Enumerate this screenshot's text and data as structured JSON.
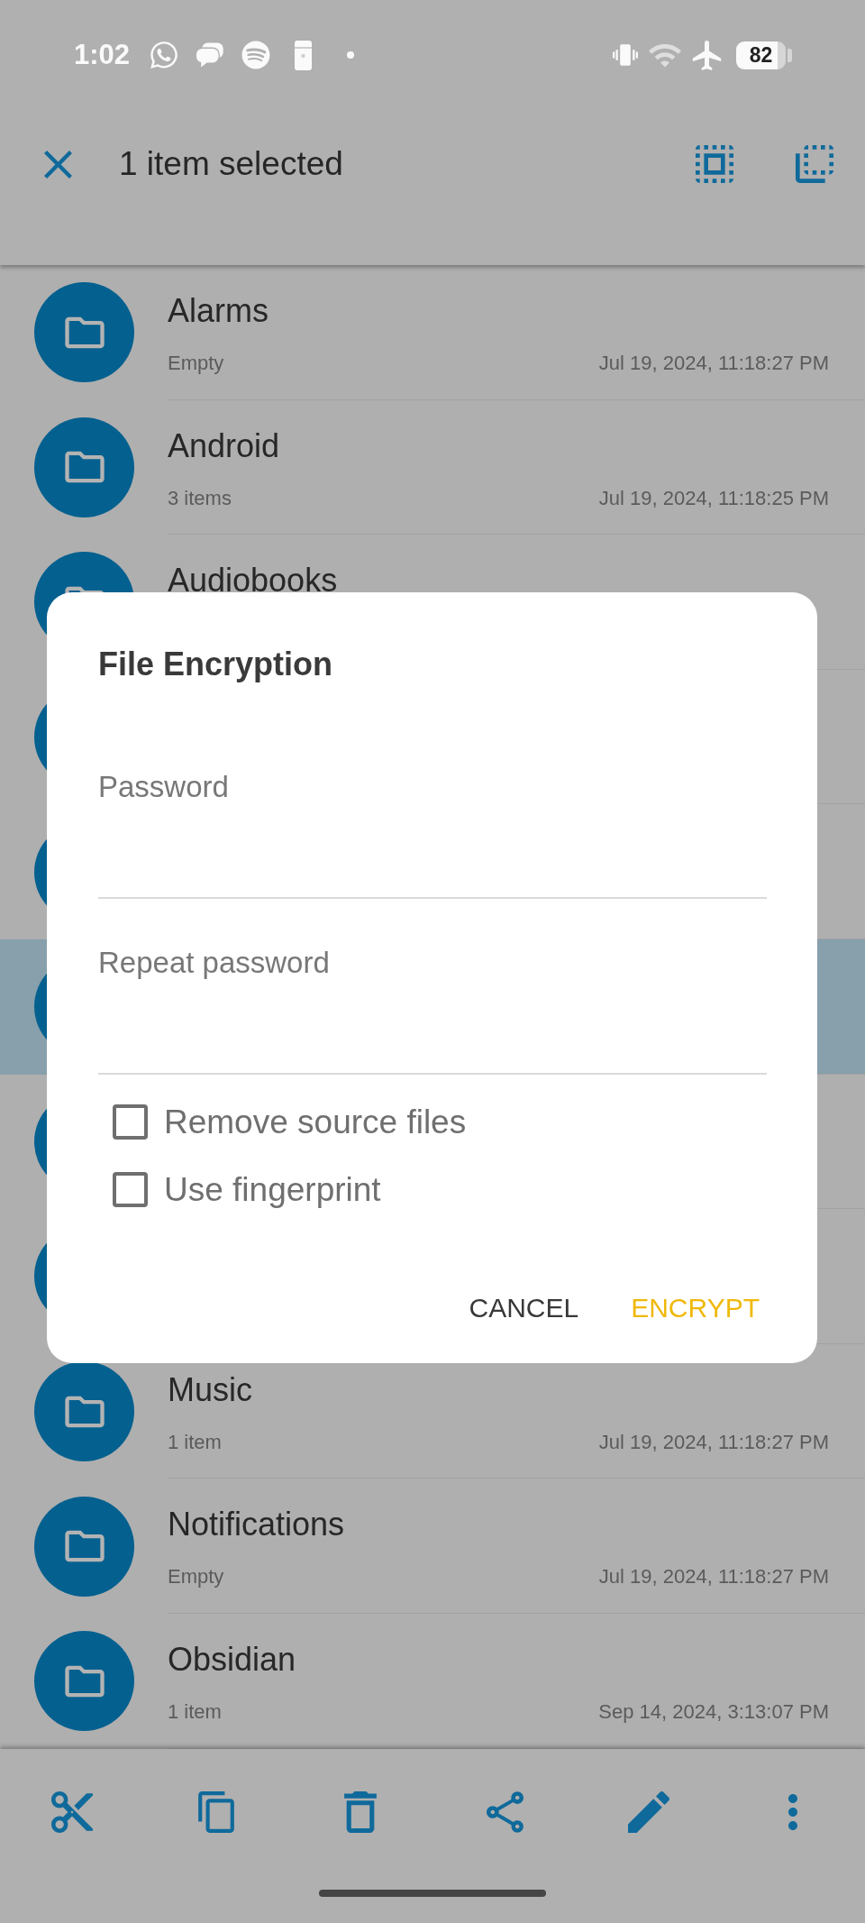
{
  "status_bar": {
    "time": "1:02",
    "battery": "82"
  },
  "toolbar": {
    "title": "1 item selected"
  },
  "file_list": {
    "rows": [
      {
        "name": "Alarms",
        "info": "Empty",
        "modified": "Jul 19, 2024, 11:18:27 PM",
        "selected": false
      },
      {
        "name": "Android",
        "info": "3 items",
        "modified": "Jul 19, 2024, 11:18:25 PM",
        "selected": false
      },
      {
        "name": "Audiobooks",
        "selected": false
      },
      {
        "selected": false
      },
      {
        "selected": false
      },
      {
        "selected": true
      },
      {
        "selected": false
      },
      {
        "selected": false
      },
      {
        "name": "Music",
        "info": "1 item",
        "modified": "Jul 19, 2024, 11:18:27 PM",
        "selected": false
      },
      {
        "name": "Notifications",
        "info": "Empty",
        "modified": "Jul 19, 2024, 11:18:27 PM",
        "selected": false
      },
      {
        "name": "Obsidian",
        "info": "1 item",
        "modified": "Sep 14, 2024, 3:13:07 PM",
        "selected": false
      }
    ]
  },
  "dialog": {
    "title": "File Encryption",
    "fields": [
      {
        "placeholder": "Password"
      },
      {
        "placeholder": "Repeat password"
      }
    ],
    "options": [
      {
        "label": "Remove source files",
        "checked": false
      },
      {
        "label": "Use fingerprint",
        "checked": false
      }
    ],
    "buttons": [
      {
        "label": "CANCEL",
        "kind": "neutral"
      },
      {
        "label": "ENCRYPT",
        "kind": "primary"
      }
    ]
  }
}
